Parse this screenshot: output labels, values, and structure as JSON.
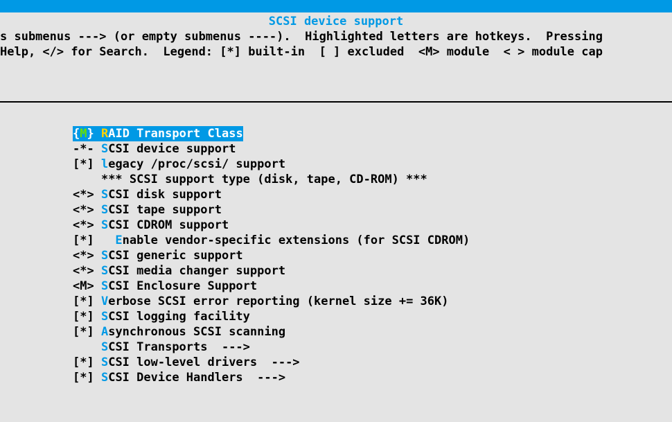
{
  "title": "SCSI device support",
  "help_line1": "s submenus ---> (or empty submenus ----).  Highlighted letters are hotkeys.  Pressing",
  "help_line2": "Help, </> for Search.  Legend: [*] built-in  [ ] excluded  <M> module  < > module cap",
  "selected": {
    "prefix": "{",
    "state": "M",
    "suffix": "} ",
    "hotkey": "R",
    "text": "AID Transport Class"
  },
  "items": [
    {
      "prefix": "-*- ",
      "hotkey": "S",
      "text": "CSI device support"
    },
    {
      "prefix": "[*] ",
      "hotkey": "l",
      "text": "egacy /proc/scsi/ support"
    },
    {
      "prefix": "    ",
      "hotkey": "",
      "text": "*** SCSI support type (disk, tape, CD-ROM) ***"
    },
    {
      "prefix": "<*> ",
      "hotkey": "S",
      "text": "CSI disk support"
    },
    {
      "prefix": "<*> ",
      "hotkey": "S",
      "text": "CSI tape support"
    },
    {
      "prefix": "<*> ",
      "hotkey": "S",
      "text": "CSI CDROM support"
    },
    {
      "prefix": "[*]   ",
      "hotkey": "E",
      "text": "nable vendor-specific extensions (for SCSI CDROM)"
    },
    {
      "prefix": "<*> ",
      "hotkey": "S",
      "text": "CSI generic support"
    },
    {
      "prefix": "<*> ",
      "hotkey": "S",
      "text": "CSI media changer support"
    },
    {
      "prefix": "<M> ",
      "hotkey": "S",
      "text": "CSI Enclosure Support"
    },
    {
      "prefix": "[*] ",
      "hotkey": "V",
      "text": "erbose SCSI error reporting (kernel size += 36K)"
    },
    {
      "prefix": "[*] ",
      "hotkey": "S",
      "text": "CSI logging facility"
    },
    {
      "prefix": "[*] ",
      "hotkey": "A",
      "text": "synchronous SCSI scanning"
    },
    {
      "prefix": "    ",
      "hotkey": "S",
      "text": "CSI Transports  --->"
    },
    {
      "prefix": "[*] ",
      "hotkey": "S",
      "text": "CSI low-level drivers  --->"
    },
    {
      "prefix": "[*] ",
      "hotkey": "S",
      "text": "CSI Device Handlers  --->"
    }
  ]
}
